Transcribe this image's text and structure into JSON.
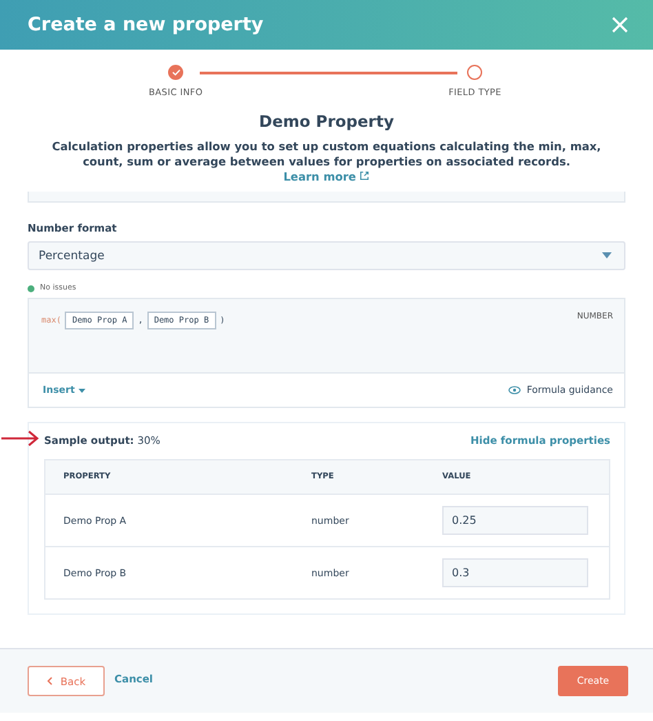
{
  "window": {
    "title": "Create a new property"
  },
  "steps": [
    {
      "label": "BASIC INFO",
      "completed": true
    },
    {
      "label": "FIELD TYPE",
      "completed": false
    }
  ],
  "heading": "Demo Property",
  "description": "Calculation properties allow you to set up custom equations calculating the min, max, count, sum or average between values for properties on associated records.",
  "learn_more": "Learn more",
  "number_format": {
    "label": "Number format",
    "value": "Percentage"
  },
  "validation": {
    "text": "No issues",
    "color": "#4caf7d"
  },
  "formula": {
    "function": "max(",
    "args": [
      "Demo Prop A",
      "Demo Prop B"
    ],
    "separator": ",",
    "close": ")",
    "type_label": "NUMBER",
    "insert": "Insert",
    "guidance": "Formula guidance"
  },
  "sample": {
    "label": "Sample output:",
    "value": "30%",
    "toggle": "Hide formula properties"
  },
  "table": {
    "columns": [
      "PROPERTY",
      "TYPE",
      "VALUE"
    ],
    "rows": [
      {
        "property": "Demo Prop A",
        "type": "number",
        "value": "0.25"
      },
      {
        "property": "Demo Prop B",
        "type": "number",
        "value": "0.3"
      }
    ]
  },
  "footer": {
    "back": "Back",
    "cancel": "Cancel",
    "create": "Create"
  }
}
